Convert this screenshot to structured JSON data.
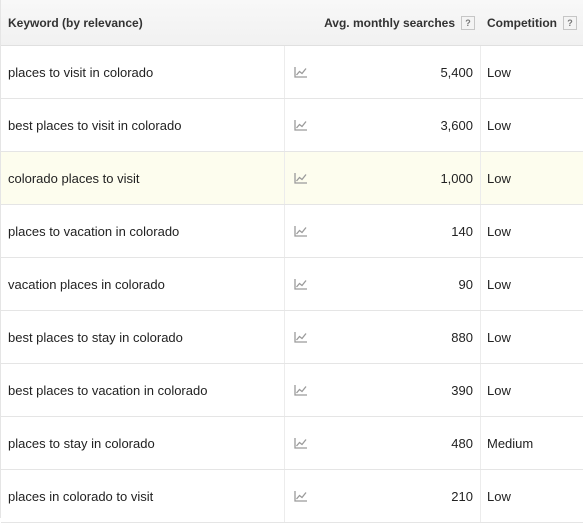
{
  "header": {
    "keyword_label": "Keyword (by relevance)",
    "searches_label": "Avg. monthly searches",
    "competition_label": "Competition",
    "help_glyph": "?"
  },
  "rows": [
    {
      "keyword": "places to visit in colorado",
      "searches": "5,400",
      "competition": "Low"
    },
    {
      "keyword": "best places to visit in colorado",
      "searches": "3,600",
      "competition": "Low"
    },
    {
      "keyword": "colorado places to visit",
      "searches": "1,000",
      "competition": "Low"
    },
    {
      "keyword": "places to vacation in colorado",
      "searches": "140",
      "competition": "Low"
    },
    {
      "keyword": "vacation places in colorado",
      "searches": "90",
      "competition": "Low"
    },
    {
      "keyword": "best places to stay in colorado",
      "searches": "880",
      "competition": "Low"
    },
    {
      "keyword": "best places to vacation in colorado",
      "searches": "390",
      "competition": "Low"
    },
    {
      "keyword": "places to stay in colorado",
      "searches": "480",
      "competition": "Medium"
    },
    {
      "keyword": "places in colorado to visit",
      "searches": "210",
      "competition": "Low"
    }
  ],
  "colors": {
    "highlight_row": "#fdfdee",
    "trend_icon": "#9a9a9a",
    "border": "#e5e5e5"
  },
  "icons": {
    "trend": "trend-chart-icon",
    "help": "help-icon"
  }
}
